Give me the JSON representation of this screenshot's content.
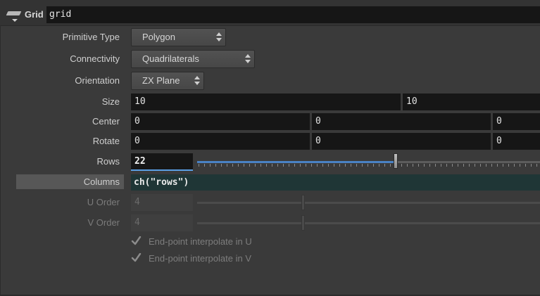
{
  "node": {
    "type_label": "Grid",
    "name_value": "grid",
    "icon": "grid-plane-icon"
  },
  "params": {
    "primitive_type": {
      "label": "Primitive Type",
      "value": "Polygon"
    },
    "connectivity": {
      "label": "Connectivity",
      "value": "Quadrilaterals"
    },
    "orientation": {
      "label": "Orientation",
      "value": "ZX Plane"
    },
    "size": {
      "label": "Size",
      "values": [
        "10",
        "10"
      ]
    },
    "center": {
      "label": "Center",
      "values": [
        "0",
        "0",
        "0"
      ]
    },
    "rotate": {
      "label": "Rotate",
      "values": [
        "0",
        "0",
        "0"
      ]
    },
    "rows": {
      "label": "Rows",
      "value": "22",
      "slider_fraction": 0.58
    },
    "columns": {
      "label": "Columns",
      "expression": "ch(\"rows\")"
    },
    "u_order": {
      "label": "U Order",
      "value": "4",
      "slider_fraction": 0.31
    },
    "v_order": {
      "label": "V Order",
      "value": "4",
      "slider_fraction": 0.31
    },
    "endpoint_u": {
      "label": "End-point interpolate in U",
      "checked": true
    },
    "endpoint_v": {
      "label": "End-point interpolate in V",
      "checked": true
    }
  },
  "colors": {
    "background": "#3a3a3a",
    "field": "#161616",
    "expression_field": "#1f3636",
    "slider_fill": "#4a82c4",
    "focus_underline": "#5aa0e6"
  }
}
